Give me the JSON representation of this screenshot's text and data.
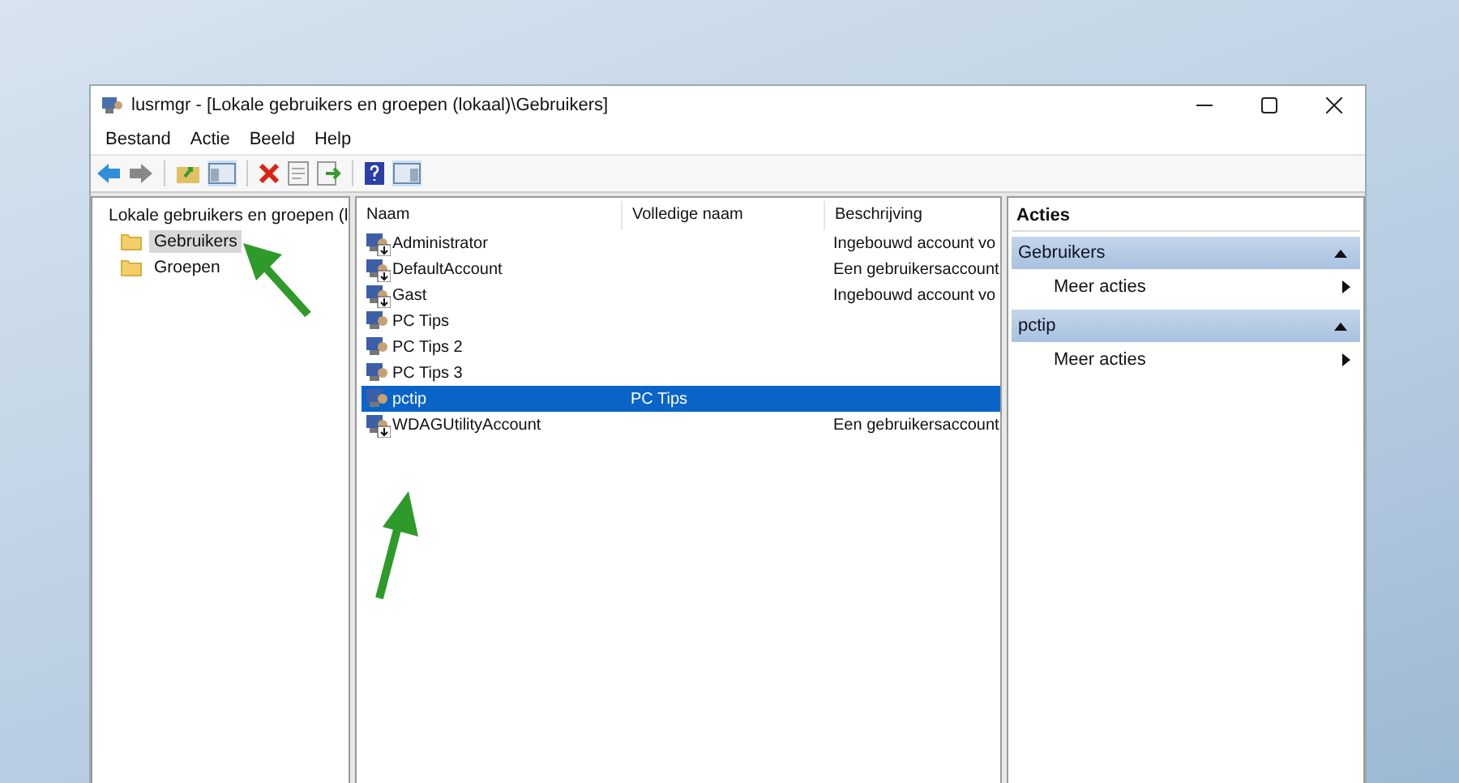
{
  "window": {
    "title": "lusrmgr - [Lokale gebruikers en groepen (lokaal)\\Gebruikers]"
  },
  "menu": [
    "Bestand",
    "Actie",
    "Beeld",
    "Help"
  ],
  "tree": {
    "label": "Lokale gebruikers en groepen (l",
    "children": [
      {
        "label": "Gebruikers",
        "selected": true
      },
      {
        "label": "Groepen",
        "selected": false
      }
    ]
  },
  "table": {
    "columns": [
      "Naam",
      "Volledige naam",
      "Beschrijving"
    ],
    "rows": [
      {
        "cells": [
          "Administrator",
          "",
          "Ingebouwd account vo"
        ],
        "disabled": true,
        "selected": false
      },
      {
        "cells": [
          "DefaultAccount",
          "",
          "Een gebruikersaccount"
        ],
        "disabled": true,
        "selected": false
      },
      {
        "cells": [
          "Gast",
          "",
          "Ingebouwd account vo"
        ],
        "disabled": true,
        "selected": false
      },
      {
        "cells": [
          "PC Tips",
          "",
          ""
        ],
        "disabled": false,
        "selected": false
      },
      {
        "cells": [
          "PC Tips 2",
          "",
          ""
        ],
        "disabled": false,
        "selected": false
      },
      {
        "cells": [
          "PC Tips 3",
          "",
          ""
        ],
        "disabled": false,
        "selected": false
      },
      {
        "cells": [
          "pctip",
          "PC Tips",
          ""
        ],
        "disabled": false,
        "selected": true
      },
      {
        "cells": [
          "WDAGUtilityAccount",
          "",
          "Een gebruikersaccount"
        ],
        "disabled": true,
        "selected": false
      }
    ]
  },
  "actions": {
    "title": "Acties",
    "groups": [
      {
        "title": "Gebruikers",
        "expanded": true,
        "items": [
          "Meer acties"
        ]
      },
      {
        "title": "pctip",
        "expanded": true,
        "items": [
          "Meer acties"
        ]
      }
    ]
  }
}
